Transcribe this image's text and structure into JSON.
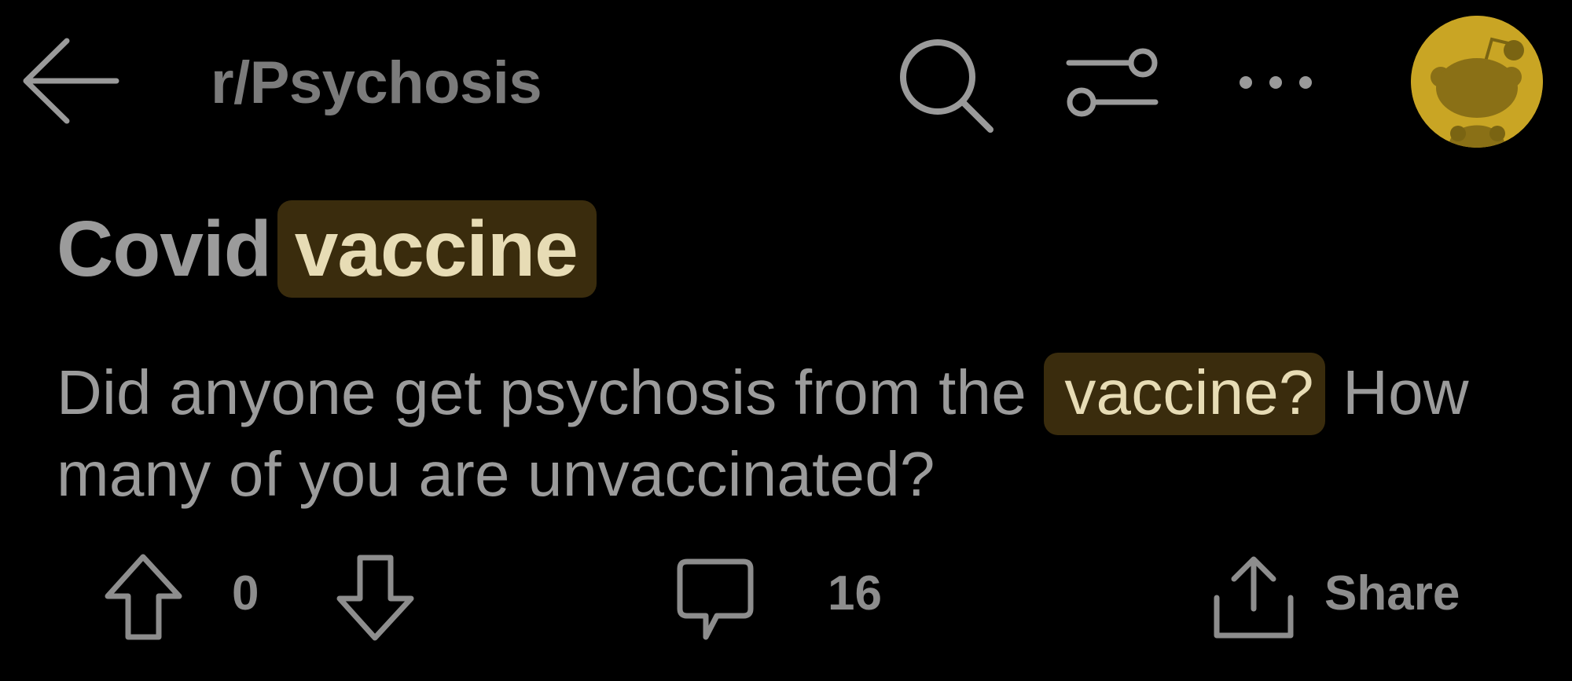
{
  "header": {
    "subreddit": "r/Psychosis",
    "back_icon": "arrow-left-icon",
    "search_icon": "search-icon",
    "filter_icon": "sort-filter-icon",
    "more_icon": "more-horizontal-icon",
    "avatar_icon": "snoo-avatar-icon"
  },
  "post": {
    "title_plain": "Covid",
    "title_highlight": "vaccine",
    "body_before": "Did anyone get psychosis from the",
    "body_highlight": "vaccine?",
    "body_after": "How many of you are unvaccinated?"
  },
  "actions": {
    "score": "0",
    "comment_count": "16",
    "share_label": "Share"
  },
  "colors": {
    "background": "#000000",
    "text": "#9b9b9b",
    "highlight_bg": "#3a2c0d",
    "highlight_text": "#e7dcb5",
    "avatar": "#c9a524"
  }
}
